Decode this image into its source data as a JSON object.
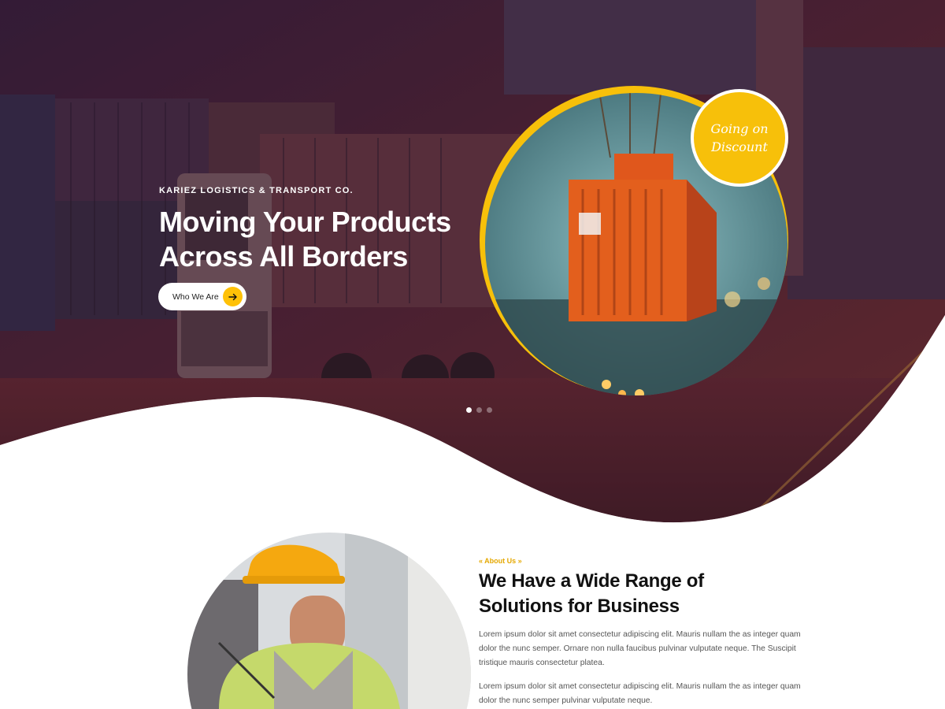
{
  "hero": {
    "eyebrow": "KARIEZ LOGISTICS & TRANSPORT CO.",
    "title_line1": "Moving Your Products",
    "title_line2": "Across All Borders",
    "cta_label": "Who We Are",
    "badge_line1": "Going on",
    "badge_line2": "Discount",
    "slider_dots": 3,
    "active_dot": 1
  },
  "about": {
    "eyebrow": "« About Us »",
    "title_line1": "We Have a Wide Range of",
    "title_line2": "Solutions for Business",
    "paragraph1": "Lorem ipsum dolor sit amet consectetur adipiscing elit. Mauris nullam the as integer quam dolor the nunc semper. Ornare non nulla faucibus pulvinar vulputate neque. The Suscipit tristique mauris consectetur platea.",
    "paragraph2": "Lorem ipsum dolor sit amet consectetur adipiscing elit. Mauris nullam the as integer quam dolor the nunc semper pulvinar vulputate neque."
  },
  "colors": {
    "accent": "#ffc107",
    "hero_overlay": "#5a1f2a",
    "text_dark": "#111111"
  },
  "icons": [
    "arrow-right-icon"
  ]
}
